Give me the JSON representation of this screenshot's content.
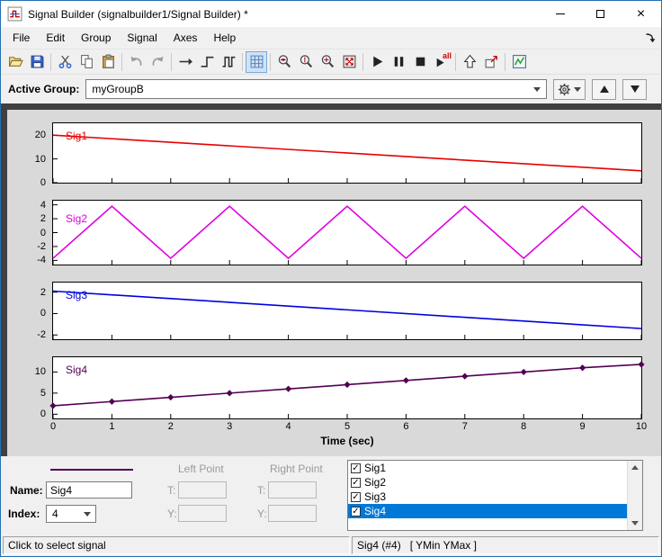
{
  "window": {
    "title": "Signal Builder (signalbuilder1/Signal Builder) *"
  },
  "menu": {
    "items": [
      "File",
      "Edit",
      "Group",
      "Signal",
      "Axes",
      "Help"
    ]
  },
  "toolbar": {
    "play_all_label": "all",
    "buttons": [
      {
        "name": "open-icon"
      },
      {
        "name": "save-icon"
      },
      {
        "separator": true
      },
      {
        "name": "cut-icon"
      },
      {
        "name": "copy-icon"
      },
      {
        "name": "paste-icon"
      },
      {
        "separator": true
      },
      {
        "name": "undo-icon"
      },
      {
        "name": "redo-icon"
      },
      {
        "separator": true
      },
      {
        "name": "constant-signal-icon"
      },
      {
        "name": "step-signal-icon"
      },
      {
        "name": "pulse-signal-icon"
      },
      {
        "separator": true
      },
      {
        "name": "snap-grid-icon",
        "pressed": true
      },
      {
        "separator": true
      },
      {
        "name": "zoom-time-icon"
      },
      {
        "name": "zoom-y-icon"
      },
      {
        "name": "zoom-xy-icon"
      },
      {
        "name": "fit-view-icon"
      },
      {
        "separator": true
      },
      {
        "name": "play-icon"
      },
      {
        "name": "pause-icon"
      },
      {
        "name": "stop-icon"
      },
      {
        "name": "play-all-icon"
      },
      {
        "separator": true
      },
      {
        "name": "up-arrow-icon"
      },
      {
        "name": "export-icon"
      },
      {
        "separator": true
      },
      {
        "name": "simulink-icon"
      }
    ]
  },
  "active_group": {
    "label": "Active Group:",
    "value": "myGroupB"
  },
  "chart_data": [
    {
      "type": "line",
      "id": "sig1",
      "name": "Sig1",
      "color": "#e60000",
      "x": [
        0,
        10
      ],
      "y": [
        20,
        5
      ],
      "xlim": [
        0,
        10
      ],
      "ylim": [
        0,
        25
      ],
      "yticks": [
        0,
        10,
        20
      ]
    },
    {
      "type": "line",
      "id": "sig2",
      "name": "Sig2",
      "color": "#e000e0",
      "x": [
        0,
        1,
        2,
        3,
        4,
        5,
        6,
        7,
        8,
        9,
        10
      ],
      "y": [
        -3.7,
        3.8,
        -3.7,
        3.8,
        -3.7,
        3.8,
        -3.7,
        3.8,
        -3.7,
        3.8,
        -3.7
      ],
      "xlim": [
        0,
        10
      ],
      "ylim": [
        -4.6,
        4.6
      ],
      "yticks": [
        -4,
        -2,
        0,
        2,
        4
      ]
    },
    {
      "type": "line",
      "id": "sig3",
      "name": "Sig3",
      "color": "#0000e0",
      "x": [
        0,
        10
      ],
      "y": [
        2.1,
        -1.4
      ],
      "xlim": [
        0,
        10
      ],
      "ylim": [
        -2.4,
        2.9
      ],
      "yticks": [
        -2,
        0,
        2
      ]
    },
    {
      "type": "line",
      "id": "sig4",
      "name": "Sig4",
      "color": "#520052",
      "marker": "diamond",
      "x": [
        0,
        1,
        2,
        3,
        4,
        5,
        6,
        7,
        8,
        9,
        10
      ],
      "y": [
        2,
        3,
        4,
        5,
        6,
        7,
        8,
        9,
        10,
        11,
        11.8
      ],
      "xlim": [
        0,
        10
      ],
      "ylim": [
        -1,
        13.5
      ],
      "yticks": [
        0,
        5,
        10
      ],
      "xticks": [
        0,
        1,
        2,
        3,
        4,
        5,
        6,
        7,
        8,
        9,
        10
      ],
      "xlabel": "Time (sec)"
    }
  ],
  "panel": {
    "left_point": "Left Point",
    "right_point": "Right Point",
    "name_label": "Name:",
    "name_value": "Sig4",
    "index_label": "Index:",
    "index_value": "4",
    "t_label": "T:",
    "y_label": "Y:",
    "signals": [
      {
        "label": "Sig1",
        "checked": true,
        "selected": false
      },
      {
        "label": "Sig2",
        "checked": true,
        "selected": false
      },
      {
        "label": "Sig3",
        "checked": true,
        "selected": false
      },
      {
        "label": "Sig4",
        "checked": true,
        "selected": true
      }
    ]
  },
  "status": {
    "left": "Click to select signal",
    "right": "Sig4 (#4)   [ YMin YMax ]"
  }
}
